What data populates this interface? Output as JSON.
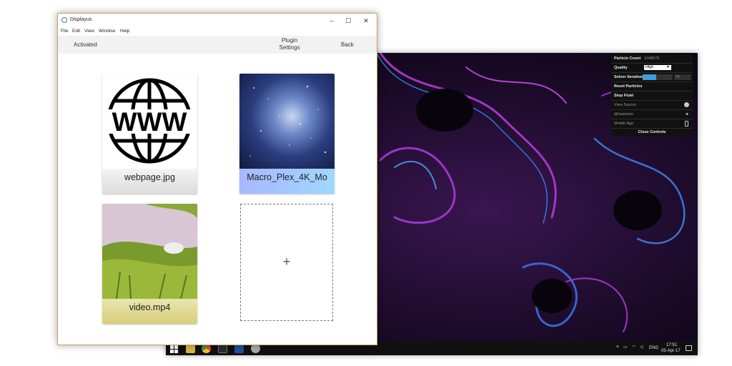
{
  "window": {
    "title": "Displayus",
    "menu": [
      "File",
      "Edit",
      "View",
      "Window",
      "Help"
    ],
    "toolbar": {
      "activated_label": "Activated",
      "plugin_settings_line1": "Plugin",
      "plugin_settings_line2": "Settings",
      "back_label": "Back"
    },
    "cards": [
      {
        "caption": "webpage.jpg",
        "icon": "www-globe-icon"
      },
      {
        "caption": "Macro_Plex_4K_Mo",
        "icon": "nebula-image"
      },
      {
        "caption": "video.mp4",
        "icon": "stream-landscape-image"
      }
    ],
    "add_card_symbol": "+"
  },
  "controls_panel": {
    "particle_count_label": "Particle Count",
    "particle_count_value": "1048576",
    "quality_label": "Quality",
    "quality_value": "High",
    "solver_iterations_label": "Solver Iterations",
    "solver_iterations_value": "20",
    "solver_iterations_fraction": 0.45,
    "reset_particles_label": "Reset Particles",
    "stop_fluid_label": "Stop Fluid",
    "view_source_label": "View Source",
    "twitter_label": "@haxiomic",
    "mobile_app_label": "Mobile App",
    "close_controls_label": "Close Controls"
  },
  "taskbar": {
    "language": "ENG",
    "time": "17:51",
    "date": "05-Apr-17"
  },
  "colors": {
    "accent_blue": "#3aa0e0",
    "fluid_purple": "#9b2fc7",
    "fluid_blue": "#2f6fe0"
  }
}
